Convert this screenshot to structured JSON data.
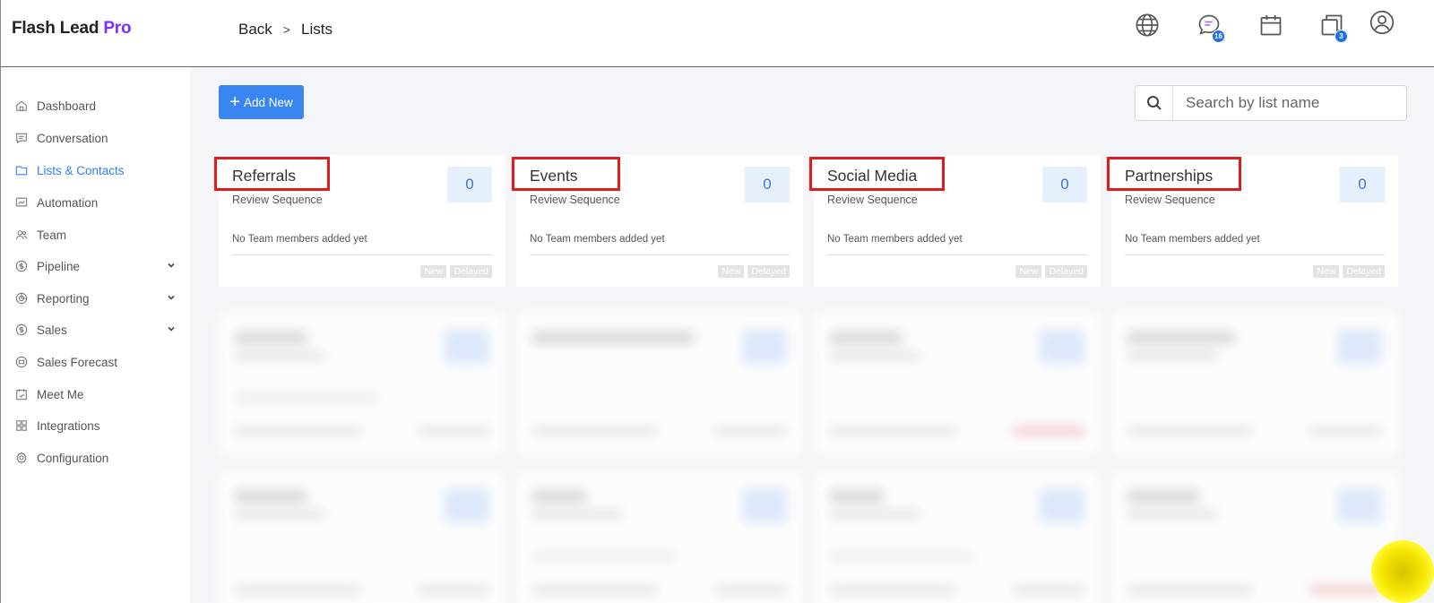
{
  "header": {
    "logo_main": "Flash Lead ",
    "logo_accent": "Pro",
    "breadcrumb": {
      "back": "Back",
      "separator": ">",
      "current": "Lists"
    },
    "icons": [
      {
        "name": "globe-icon"
      },
      {
        "name": "chat-icon",
        "badge": "16"
      },
      {
        "name": "calendar-icon"
      },
      {
        "name": "copy-icon",
        "badge": "3"
      },
      {
        "name": "user-icon"
      }
    ]
  },
  "sidebar": {
    "items": [
      {
        "label": "Dashboard",
        "icon": "home-icon",
        "active": false
      },
      {
        "label": "Conversation",
        "icon": "message-icon",
        "active": false
      },
      {
        "label": "Lists & Contacts",
        "icon": "folder-icon",
        "active": true
      },
      {
        "label": "Automation",
        "icon": "automation-icon",
        "active": false
      },
      {
        "label": "Team",
        "icon": "team-icon",
        "active": false
      },
      {
        "label": "Pipeline",
        "icon": "dollar-icon",
        "active": false,
        "expandable": true
      },
      {
        "label": "Reporting",
        "icon": "reporting-icon",
        "active": false,
        "expandable": true
      },
      {
        "label": "Sales",
        "icon": "dollar-icon",
        "active": false,
        "expandable": true
      },
      {
        "label": "Sales Forecast",
        "icon": "forecast-icon",
        "active": false
      },
      {
        "label": "Meet Me",
        "icon": "calendar-check-icon",
        "active": false
      },
      {
        "label": "Integrations",
        "icon": "grid-icon",
        "active": false
      },
      {
        "label": "Configuration",
        "icon": "gear-icon",
        "active": false
      }
    ]
  },
  "toolbar": {
    "add_label": "Add New",
    "search_placeholder": "Search by list name"
  },
  "cards": [
    {
      "title": "Referrals",
      "subtitle": "Review Sequence",
      "count": "0",
      "team": "No Team members added yet",
      "tags": [
        "New",
        "Delayed"
      ]
    },
    {
      "title": "Events",
      "subtitle": "Review Sequence",
      "count": "0",
      "team": "No Team members added yet",
      "tags": [
        "New",
        "Delayed"
      ]
    },
    {
      "title": "Social Media",
      "subtitle": "Review Sequence",
      "count": "0",
      "team": "No Team members added yet",
      "tags": [
        "New",
        "Delayed"
      ]
    },
    {
      "title": "Partnerships",
      "subtitle": "Review Sequence",
      "count": "0",
      "team": "No Team members added yet",
      "tags": [
        "New",
        "Delayed"
      ]
    }
  ],
  "colors": {
    "accent": "#3a86f0",
    "logo_accent": "#7b2ff7",
    "highlight_box": "#e01b1b",
    "active_nav": "#2f7cf6"
  }
}
